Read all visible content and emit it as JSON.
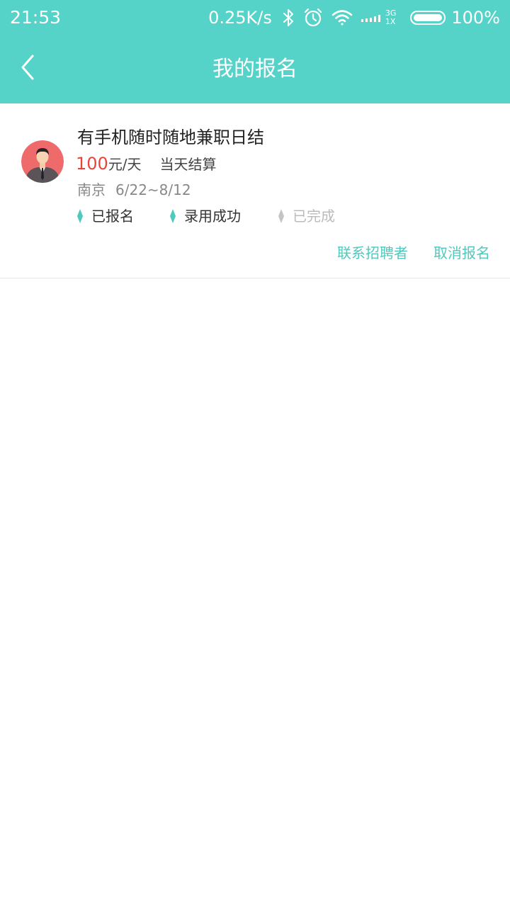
{
  "status_bar": {
    "time": "21:53",
    "net_speed": "0.25K/s",
    "net_type_top": "3G",
    "net_type_bottom": "1X",
    "battery": "100%"
  },
  "header": {
    "title": "我的报名"
  },
  "colors": {
    "accent": "#56d3c8",
    "action_text": "#4fc9bd",
    "price": "#e8443b",
    "avatar_bg": "#ef6b6b"
  },
  "icons": {
    "back": "chevron-left-icon",
    "bluetooth": "bluetooth-icon",
    "alarm": "alarm-clock-icon",
    "wifi": "wifi-icon",
    "signal": "signal-icon",
    "battery": "battery-icon",
    "step": "diamond-icon"
  },
  "job": {
    "title": "有手机随时随地兼职日结",
    "pay_amount": "100",
    "pay_unit": "元/天",
    "settlement": "当天结算",
    "location": "南京",
    "date_range": "6/22~8/12",
    "steps": [
      {
        "label": "已报名",
        "done": true
      },
      {
        "label": "录用成功",
        "done": true
      },
      {
        "label": "已完成",
        "done": false
      }
    ],
    "actions": {
      "contact": "联系招聘者",
      "cancel": "取消报名"
    }
  }
}
